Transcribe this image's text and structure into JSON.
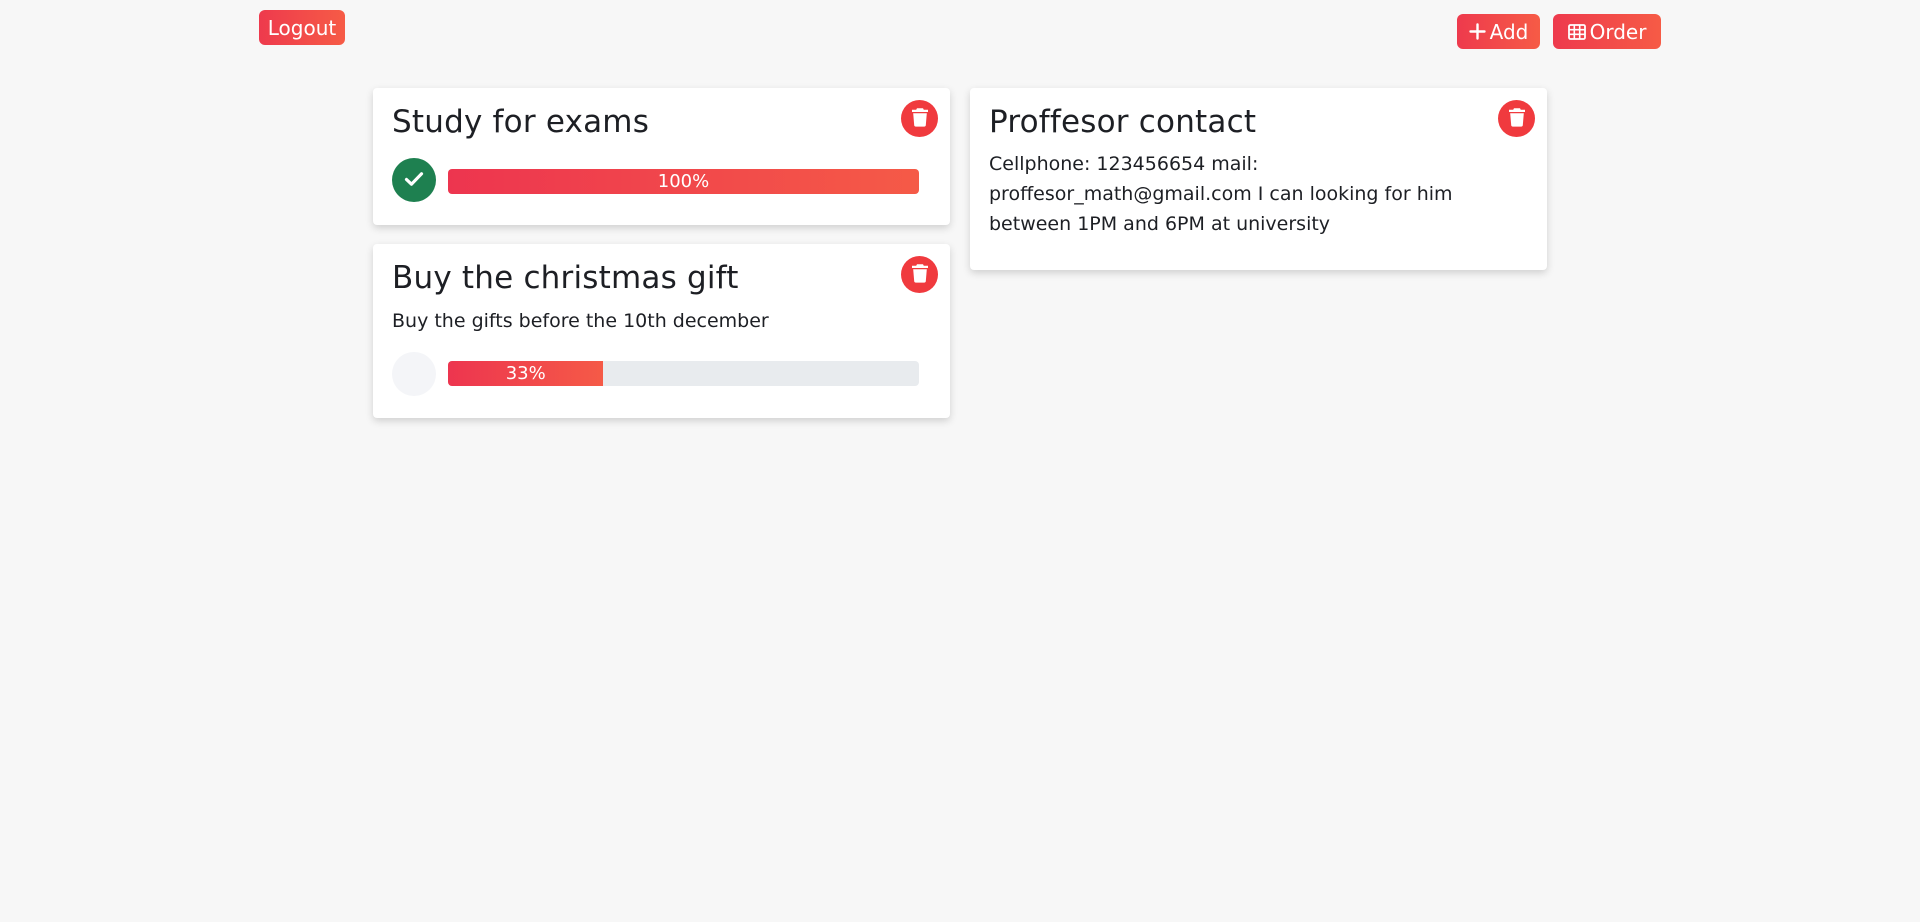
{
  "header": {
    "logout_label": "Logout",
    "add_label": "Add",
    "order_label": "Order"
  },
  "colors": {
    "accent_gradient_start": "#ee3a4d",
    "accent_gradient_end": "#f65b46",
    "delete_red": "#f03a3e",
    "done_green": "#1e8050",
    "track_gray": "#e8ebee",
    "background": "#f7f7f7"
  },
  "icons": {
    "add": "plus-icon",
    "order": "table-grid-icon",
    "delete": "trash-icon",
    "done": "check-icon"
  },
  "notes": [
    {
      "title": "Study for exams",
      "description": "",
      "completed": true,
      "progress": 100,
      "progress_label": "100%"
    },
    {
      "title": "Buy the christmas gift",
      "description": "Buy the gifts before the 10th december",
      "completed": false,
      "progress": 33,
      "progress_label": "33%"
    },
    {
      "title": "Proffesor contact",
      "description": "Cellphone: 123456654 mail: proffesor_math@gmail.com I can looking for him between 1PM and 6PM at university"
    }
  ]
}
